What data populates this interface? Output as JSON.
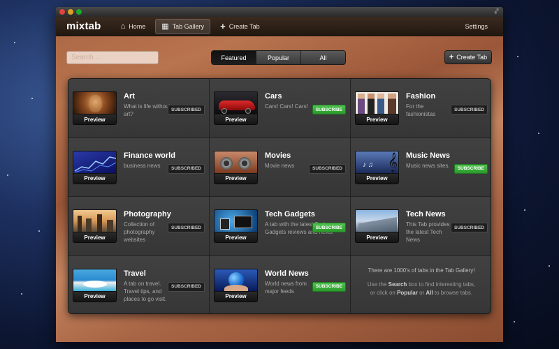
{
  "app": {
    "logo": "mixtab",
    "nav": [
      {
        "label": "Home",
        "icon": "home-icon"
      },
      {
        "label": "Tab Gallery",
        "icon": "grid-icon"
      },
      {
        "label": "Create Tab",
        "icon": "plus-icon"
      }
    ],
    "settings_label": "Settings"
  },
  "toolbar": {
    "search_placeholder": "Search ...",
    "segments": [
      "Featured",
      "Popular",
      "All"
    ],
    "active_segment": "Featured",
    "create_label": "Create Tab"
  },
  "preview_label": "Preview",
  "tabs": [
    {
      "title": "Art",
      "desc": "What is life without art?",
      "status": "SUBSCRIBED"
    },
    {
      "title": "Cars",
      "desc": "Cars! Cars! Cars!",
      "status": "SUBSCRIBE"
    },
    {
      "title": "Fashion",
      "desc": "For the fashionistas",
      "status": "SUBSCRIBED"
    },
    {
      "title": "Finance world",
      "desc": "business news",
      "status": "SUBSCRIBED"
    },
    {
      "title": "Movies",
      "desc": "Movie news",
      "status": "SUBSCRIBED"
    },
    {
      "title": "Music News",
      "desc": "Music news sites.",
      "status": "SUBSCRIBE"
    },
    {
      "title": "Photography",
      "desc": "Collection of photography websites",
      "status": "SUBSCRIBED"
    },
    {
      "title": "Tech Gadgets",
      "desc": "A tab with the latest Tech Gadgets reviews and news!",
      "status": "SUBSCRIBE"
    },
    {
      "title": "Tech News",
      "desc": "This Tab provides the latest Tech News",
      "status": "SUBSCRIBED"
    },
    {
      "title": "Travel",
      "desc": "A tab on travel. Travel tips, and places to go visit.",
      "status": "SUBSCRIBED"
    },
    {
      "title": "World News",
      "desc": "World news from major feeds",
      "status": "SUBSCRIBE"
    }
  ],
  "info": {
    "title": "There are 1000's of tabs in the Tab Gallery!",
    "line1_pre": "Use the ",
    "line1_bold": "Search",
    "line1_post": " box to find interesting tabs,",
    "line2_pre": "or click on ",
    "line2_bold1": "Popular",
    "line2_mid": " or ",
    "line2_bold2": "All",
    "line2_post": " to browse tabs."
  },
  "colors": {
    "subscribe_green": "#3aae3a",
    "subscribed_dark": "#1e1e1e",
    "panel": "#3a3a3a"
  }
}
